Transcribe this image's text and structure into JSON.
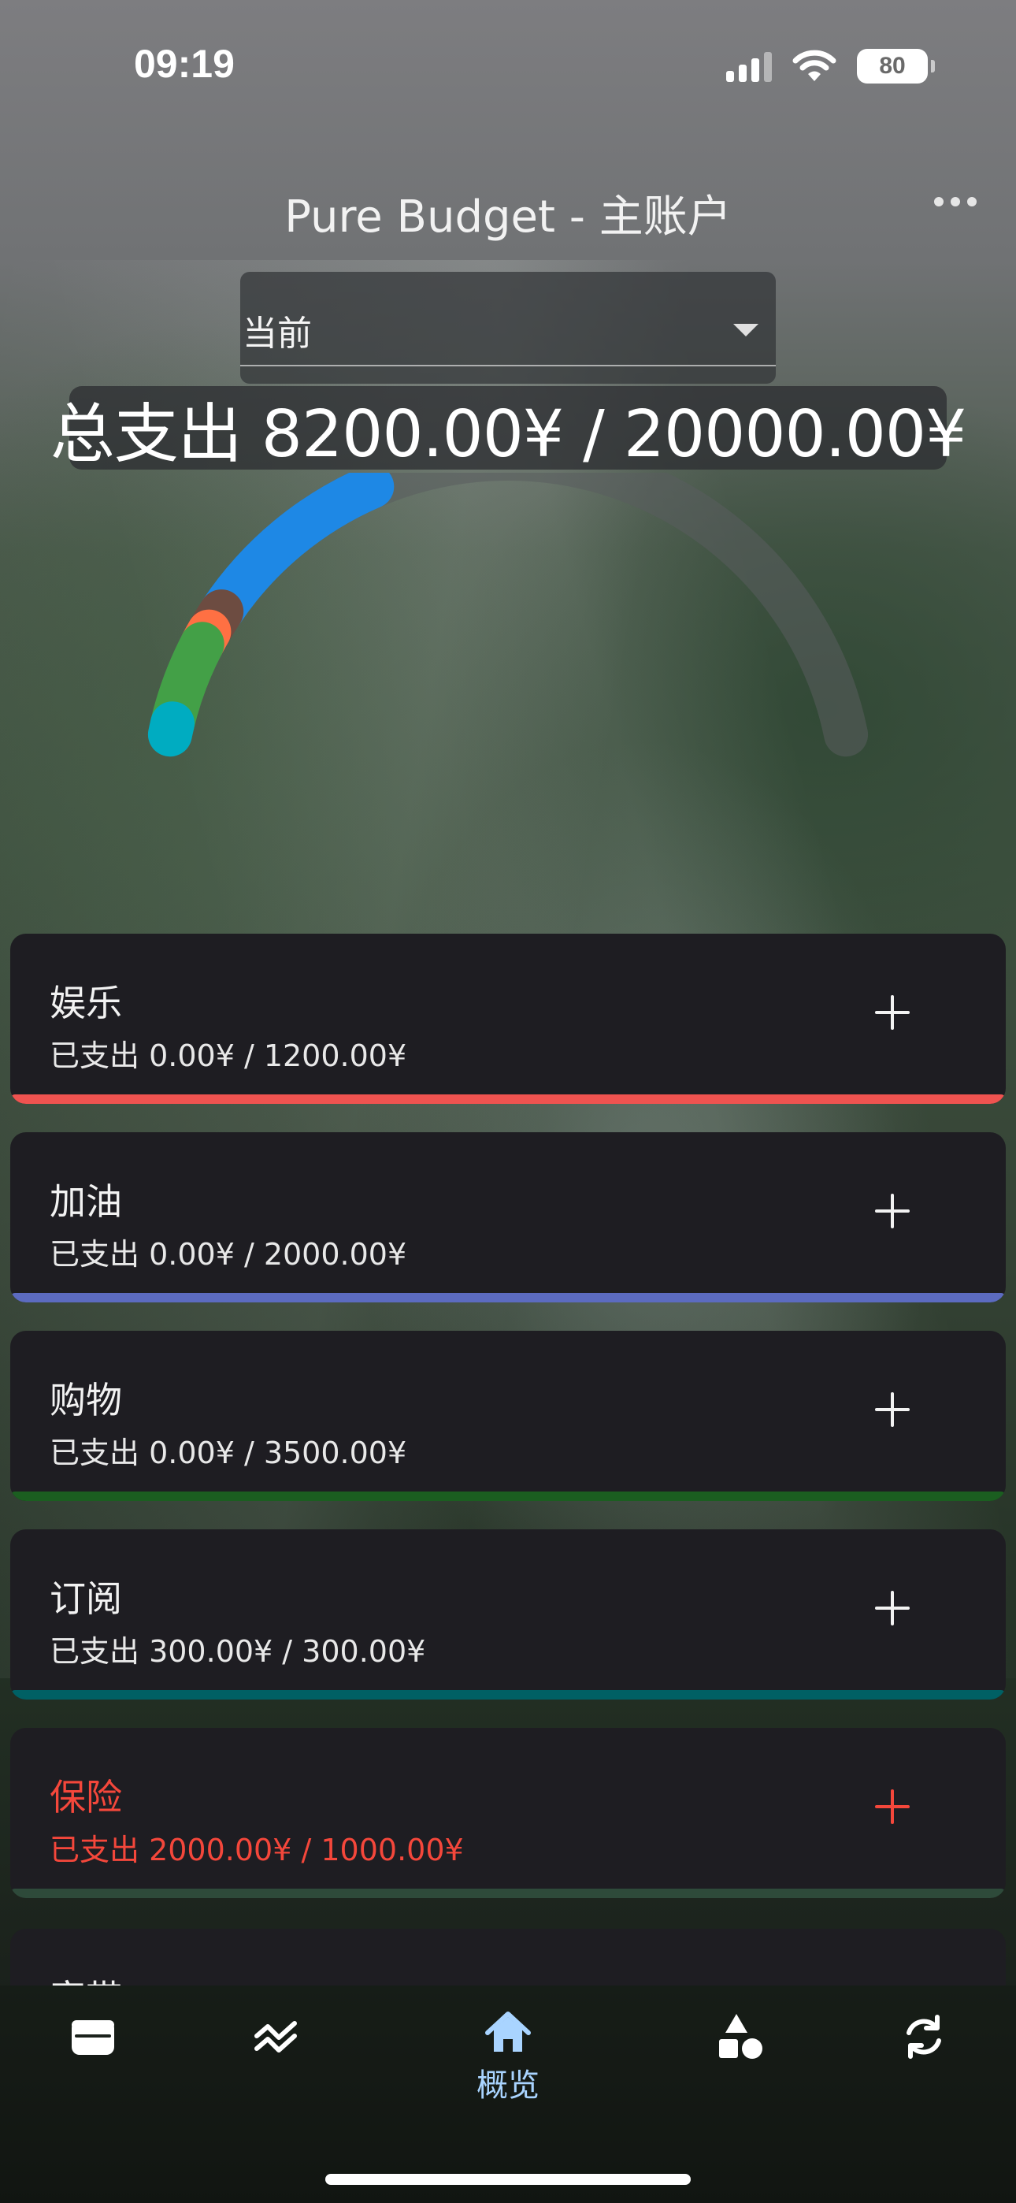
{
  "status_bar": {
    "time": "09:19",
    "battery": "80",
    "icons": [
      "signal-icon",
      "wifi-icon",
      "battery-icon"
    ]
  },
  "header": {
    "title": "Pure Budget - 主账户",
    "menu_icon": "more-icon"
  },
  "period_select": {
    "value": "当前"
  },
  "summary": {
    "total_text": "总支出 8200.00¥ / 20000.00¥",
    "spent": 8200,
    "budget": 20000
  },
  "gauge": {
    "track_color": "#5a5c5e",
    "segments": [
      {
        "color": "#1e88e5",
        "fraction": 0.21
      },
      {
        "color": "#6d4c41",
        "fraction": 0.025
      },
      {
        "color": "#ff7043",
        "fraction": 0.015
      },
      {
        "color": "#43a047",
        "fraction": 0.09
      },
      {
        "color": "#00acc1",
        "fraction": 0.012
      }
    ]
  },
  "categories": [
    {
      "name": "娱乐",
      "spent": "已支出 0.00¥ / 1200.00¥",
      "color": "#ef5350",
      "over": false
    },
    {
      "name": "加油",
      "spent": "已支出 0.00¥ / 2000.00¥",
      "color": "#5c6bc0",
      "over": false
    },
    {
      "name": "购物",
      "spent": "已支出 0.00¥ / 3500.00¥",
      "color": "#1b5e20",
      "over": false
    },
    {
      "name": "订阅",
      "spent": "已支出 300.00¥ / 300.00¥",
      "color": "#006064",
      "over": false
    },
    {
      "name": "保险",
      "spent": "已支出 2000.00¥ / 1000.00¥",
      "color": "#2e4a3a",
      "over": true
    },
    {
      "name": "家带",
      "spent": "",
      "color": "#333333",
      "over": false
    }
  ],
  "tabs": [
    {
      "icon": "wallet-icon",
      "label": ""
    },
    {
      "icon": "trend-icon",
      "label": ""
    },
    {
      "icon": "home-icon",
      "label": "概览",
      "active": true
    },
    {
      "icon": "shapes-icon",
      "label": ""
    },
    {
      "icon": "sync-icon",
      "label": ""
    }
  ],
  "accent_color": "#a9d4ff"
}
